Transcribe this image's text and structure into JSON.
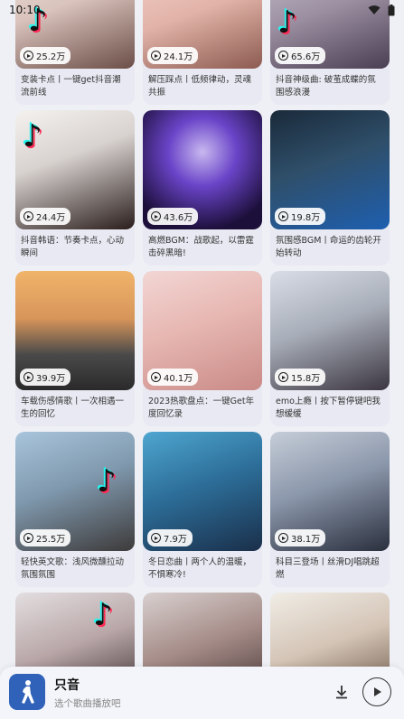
{
  "status_bar": {
    "time": "10:10"
  },
  "cards": [
    {
      "plays": "25.2万",
      "title": "变装卡点丨一键get抖音潮流前线"
    },
    {
      "plays": "24.1万",
      "title": "解压踩点丨低频律动，灵魂共振"
    },
    {
      "plays": "65.6万",
      "title": "抖音神级曲: 破茧成蝶的氛围感浪漫"
    },
    {
      "plays": "24.4万",
      "title": "抖音韩语：节奏卡点，心动瞬间"
    },
    {
      "plays": "43.6万",
      "title": "高燃BGM：战歌起，以雷霆击碎黑暗!"
    },
    {
      "plays": "19.8万",
      "title": "氛围感BGM丨命运的齿轮开始转动"
    },
    {
      "plays": "39.9万",
      "title": "车载伤感情歌丨一次相遇一生的回忆"
    },
    {
      "plays": "40.1万",
      "title": "2023热歌盘点：一键Get年度回忆录"
    },
    {
      "plays": "15.8万",
      "title": "emo上瘾丨按下暂停键吧我想缓缓"
    },
    {
      "plays": "25.5万",
      "title": "轻快英文歌：浅风微醺拉动氛围氛围"
    },
    {
      "plays": "7.9万",
      "title": "冬日恋曲丨两个人的温暖，不惧寒冷!"
    },
    {
      "plays": "38.1万",
      "title": "科目三登场丨丝滑DJ唱跳超燃"
    }
  ],
  "player": {
    "title": "只音",
    "subtitle": "选个歌曲播放吧"
  },
  "colors": {
    "background": "#eef0f6",
    "player_bg": "#f4f5fa",
    "avatar_bg": "#2f62b8"
  },
  "icons": [
    "wifi-icon",
    "battery-icon",
    "play-count-icon",
    "download-icon",
    "play-icon",
    "tiktok-logo-icon",
    "walking-figure-icon"
  ]
}
